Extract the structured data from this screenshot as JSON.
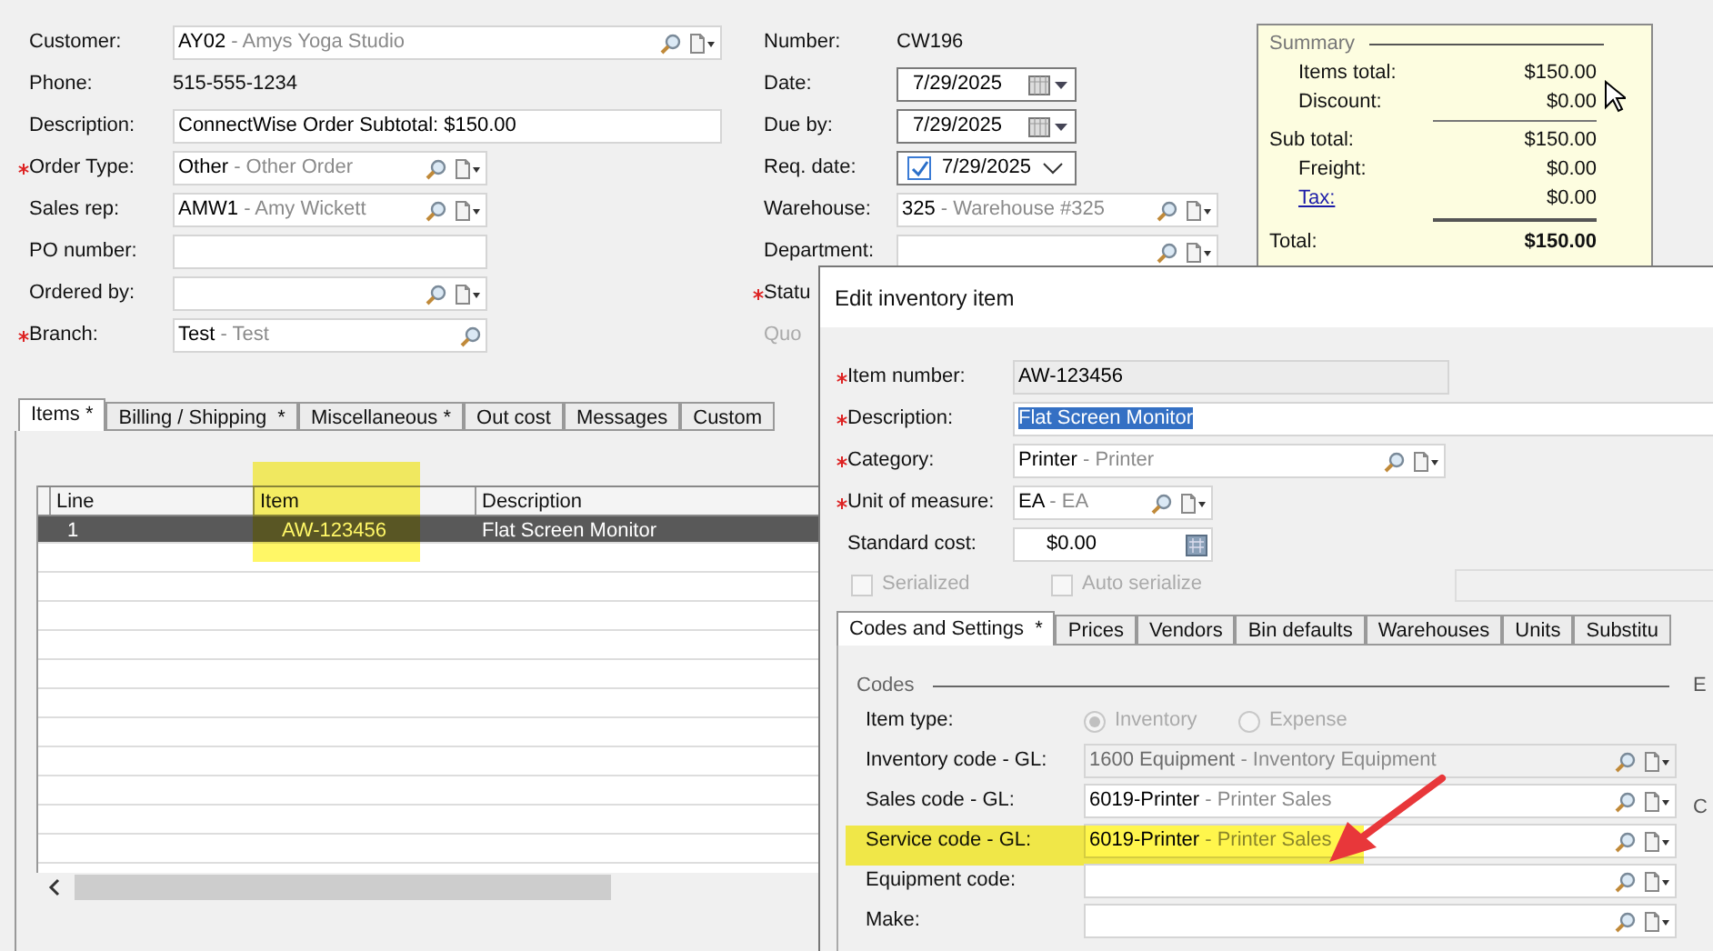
{
  "order_form": {
    "left_fields": [
      {
        "label": "Customer:",
        "kind": "lookup",
        "value": "AY02",
        "desc": "- Amys Yoga Studio",
        "required": false
      },
      {
        "label": "Phone:",
        "kind": "static",
        "value": "515-555-1234",
        "required": false
      },
      {
        "label": "Description:",
        "kind": "text",
        "value": "ConnectWise Order Subtotal: $150.00",
        "required": false
      },
      {
        "label": "Order Type:",
        "kind": "lookup",
        "value": "Other",
        "desc": "- Other Order",
        "required": true
      },
      {
        "label": "Sales rep:",
        "kind": "lookup",
        "value": "AMW1",
        "desc": "- Amy Wickett",
        "required": false
      },
      {
        "label": "PO number:",
        "kind": "text",
        "required": false
      },
      {
        "label": "Ordered by:",
        "kind": "lookup",
        "required": false
      },
      {
        "label": "Branch:",
        "kind": "search",
        "value": "Test",
        "desc": "- Test",
        "required": true
      }
    ],
    "right_fields": [
      {
        "label": "Number:",
        "kind": "static",
        "value": "CW196",
        "required": false,
        "disabled": false
      },
      {
        "label": "Date:",
        "kind": "date",
        "value": "7/29/2025",
        "required": false,
        "disabled": false
      },
      {
        "label": "Due by:",
        "kind": "date",
        "value": "7/29/2025",
        "required": false,
        "disabled": false
      },
      {
        "label": "Req. date:",
        "kind": "date_check",
        "value": "7/29/2025",
        "checked": true,
        "required": false,
        "disabled": false
      },
      {
        "label": "Warehouse:",
        "kind": "lookup",
        "value": "325",
        "desc": "- Warehouse #325",
        "required": false,
        "disabled": false
      },
      {
        "label": "Department:",
        "kind": "lookup",
        "required": false,
        "disabled": false
      },
      {
        "label": "Statu",
        "kind": "label_only",
        "required": true,
        "disabled": false
      },
      {
        "label": "Quo",
        "kind": "label_only",
        "required": false,
        "disabled": true
      }
    ],
    "summary": {
      "title": "Summary",
      "rows": [
        {
          "kind": "item",
          "label": "Items total:",
          "value": "$150.00"
        },
        {
          "kind": "item",
          "label": "Discount:",
          "value": "$0.00"
        },
        {
          "kind": "rule"
        },
        {
          "kind": "plain",
          "label": "Sub total:",
          "value": "$150.00"
        },
        {
          "kind": "item",
          "label": "Freight:",
          "value": "$0.00"
        },
        {
          "kind": "link",
          "label": "Tax:",
          "value": "$0.00"
        },
        {
          "kind": "rule_thick"
        },
        {
          "kind": "total",
          "label": "Total:",
          "value": "$150.00"
        }
      ]
    },
    "tabs": [
      {
        "label": "Items *",
        "selected": true
      },
      {
        "label": "Billing / Shipping  *",
        "selected": false
      },
      {
        "label": "Miscellaneous *",
        "selected": false
      },
      {
        "label": "Out cost",
        "selected": false
      },
      {
        "label": "Messages",
        "selected": false
      },
      {
        "label": "Custom",
        "selected": false
      }
    ],
    "grid": {
      "columns": [
        {
          "label": "Line",
          "highlighted": false
        },
        {
          "label": "Item",
          "highlighted": true
        },
        {
          "label": "Description",
          "highlighted": false
        }
      ],
      "rows": [
        {
          "cells": [
            "1",
            "AW-123456",
            "Flat Screen Monitor"
          ],
          "selected": true
        }
      ]
    }
  },
  "dialog": {
    "title": "Edit inventory item",
    "fields": [
      {
        "label": "Item number:",
        "kind": "readonly",
        "value": "AW-123456",
        "required": true,
        "selected": false
      },
      {
        "label": "Description:",
        "kind": "text",
        "value": "Flat Screen Monitor",
        "required": true,
        "selected": true
      },
      {
        "label": "Category:",
        "kind": "lookup",
        "value": "Printer",
        "desc": "- Printer",
        "required": true,
        "selected": false
      },
      {
        "label": "Unit of measure:",
        "kind": "lookup",
        "value": "EA",
        "desc": "- EA",
        "required": true,
        "selected": false
      },
      {
        "label": "Standard cost:",
        "kind": "cost",
        "value": "$0.00",
        "required": false,
        "selected": false
      }
    ],
    "checkboxes": [
      {
        "label": "Serialized",
        "checked": false,
        "disabled": true
      },
      {
        "label": "Auto serialize",
        "checked": false,
        "disabled": true
      }
    ],
    "tabs": [
      {
        "label": "Codes and Settings  *",
        "selected": true
      },
      {
        "label": "Prices",
        "selected": false
      },
      {
        "label": "Vendors",
        "selected": false
      },
      {
        "label": "Bin defaults",
        "selected": false
      },
      {
        "label": "Warehouses",
        "selected": false
      },
      {
        "label": "Units",
        "selected": false
      },
      {
        "label": "Substitu",
        "selected": false
      }
    ],
    "section": "Codes",
    "item_type": {
      "label": "Item type:",
      "options": [
        {
          "label": "Inventory",
          "selected": true,
          "disabled": true
        },
        {
          "label": "Expense",
          "selected": false,
          "disabled": true
        }
      ]
    },
    "gl_fields": [
      {
        "label": "Inventory code - GL:",
        "value": "1600 Equipment",
        "desc": "- Inventory Equipment",
        "disabled": true,
        "highlighted": false
      },
      {
        "label": "Sales code - GL:",
        "value": "6019-Printer",
        "desc": "- Printer Sales",
        "disabled": false,
        "highlighted": false
      },
      {
        "label": "Service code - GL:",
        "value": "6019-Printer",
        "desc": "- Printer Sales",
        "disabled": false,
        "highlighted": true
      },
      {
        "label": "Equipment code:",
        "disabled": false,
        "highlighted": false
      },
      {
        "label": "Make:",
        "disabled": false,
        "highlighted": false
      }
    ],
    "side_labels": [
      "E",
      "C"
    ]
  }
}
